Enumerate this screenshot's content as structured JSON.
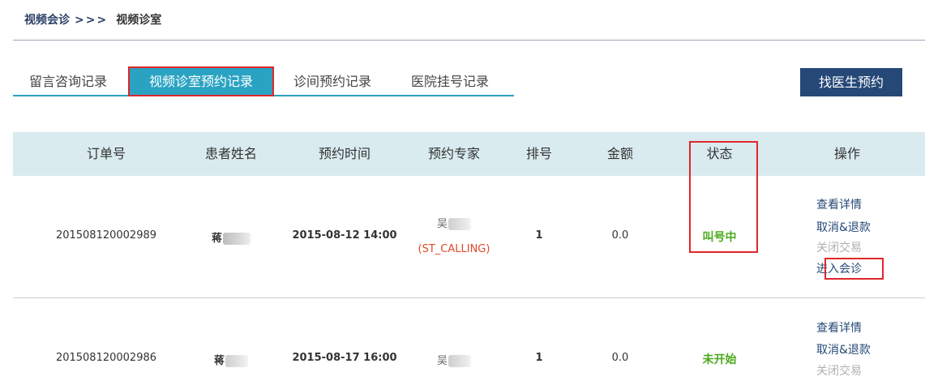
{
  "breadcrumb": {
    "root": "视频会诊",
    "sep": ">>>",
    "current": "视频诊室"
  },
  "tabs": [
    {
      "label": "留言咨询记录",
      "active": false
    },
    {
      "label": "视频诊室预约记录",
      "active": true
    },
    {
      "label": "诊间预约记录",
      "active": false
    },
    {
      "label": "医院挂号记录",
      "active": false
    }
  ],
  "find_doctor_button": "找医生预约",
  "columns": [
    "订单号",
    "患者姓名",
    "预约时间",
    "预约专家",
    "排号",
    "金额",
    "状态",
    "操作"
  ],
  "rows": [
    {
      "order_no": "201508120002989",
      "patient": "蒋",
      "time": "2015-08-12 14:00",
      "expert": "吴",
      "expert_code": "(ST_CALLING)",
      "queue": "1",
      "amount": "0.0",
      "status": "叫号中",
      "actions": [
        "查看详情",
        "取消&退款",
        "关闭交易",
        "进入会诊"
      ]
    },
    {
      "order_no": "201508120002986",
      "patient": "蒋",
      "time": "2015-08-17 16:00",
      "expert": "吴",
      "queue": "1",
      "amount": "0.0",
      "status": "未开始",
      "actions": [
        "查看详情",
        "取消&退款",
        "关闭交易"
      ]
    }
  ],
  "colors": {
    "tab_active": "#2aa3c2",
    "button_bg": "#254877",
    "header_bg": "#d9ebef",
    "status_green": "#4aaa1c",
    "highlight_red": "#e0262a",
    "code_orange": "#e0492a"
  }
}
